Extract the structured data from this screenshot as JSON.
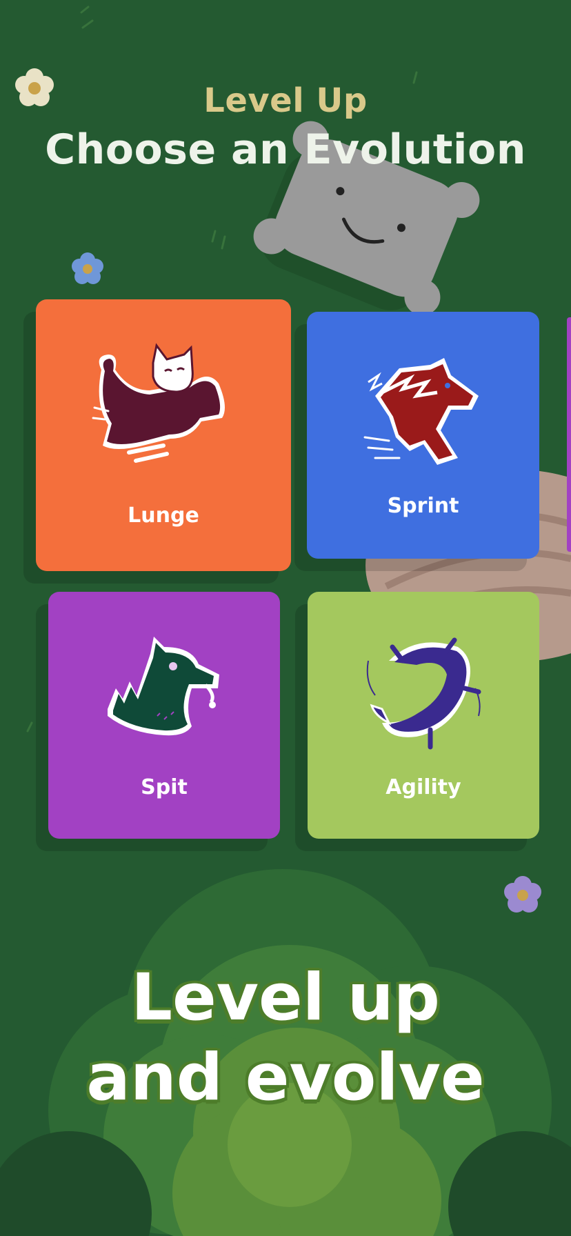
{
  "header": {
    "subtitle": "Level Up",
    "title": "Choose an Evolution"
  },
  "cards": [
    {
      "label": "Lunge",
      "color": "#f46f3c",
      "icon": "cat-lunge-icon"
    },
    {
      "label": "Sprint",
      "color": "#3f6fe0",
      "icon": "horse-sprint-icon"
    },
    {
      "label": "Spit",
      "color": "#a241c3",
      "icon": "llama-spit-icon"
    },
    {
      "label": "Agility",
      "color": "#a4c85e",
      "icon": "lizard-agility-icon"
    }
  ],
  "promo": {
    "line1": "Level up",
    "line2": "and evolve"
  },
  "colors": {
    "background": "#245a31",
    "subtitle": "#d9c98a",
    "title": "#eef3ea",
    "promo_outline": "#4d7d2a"
  }
}
